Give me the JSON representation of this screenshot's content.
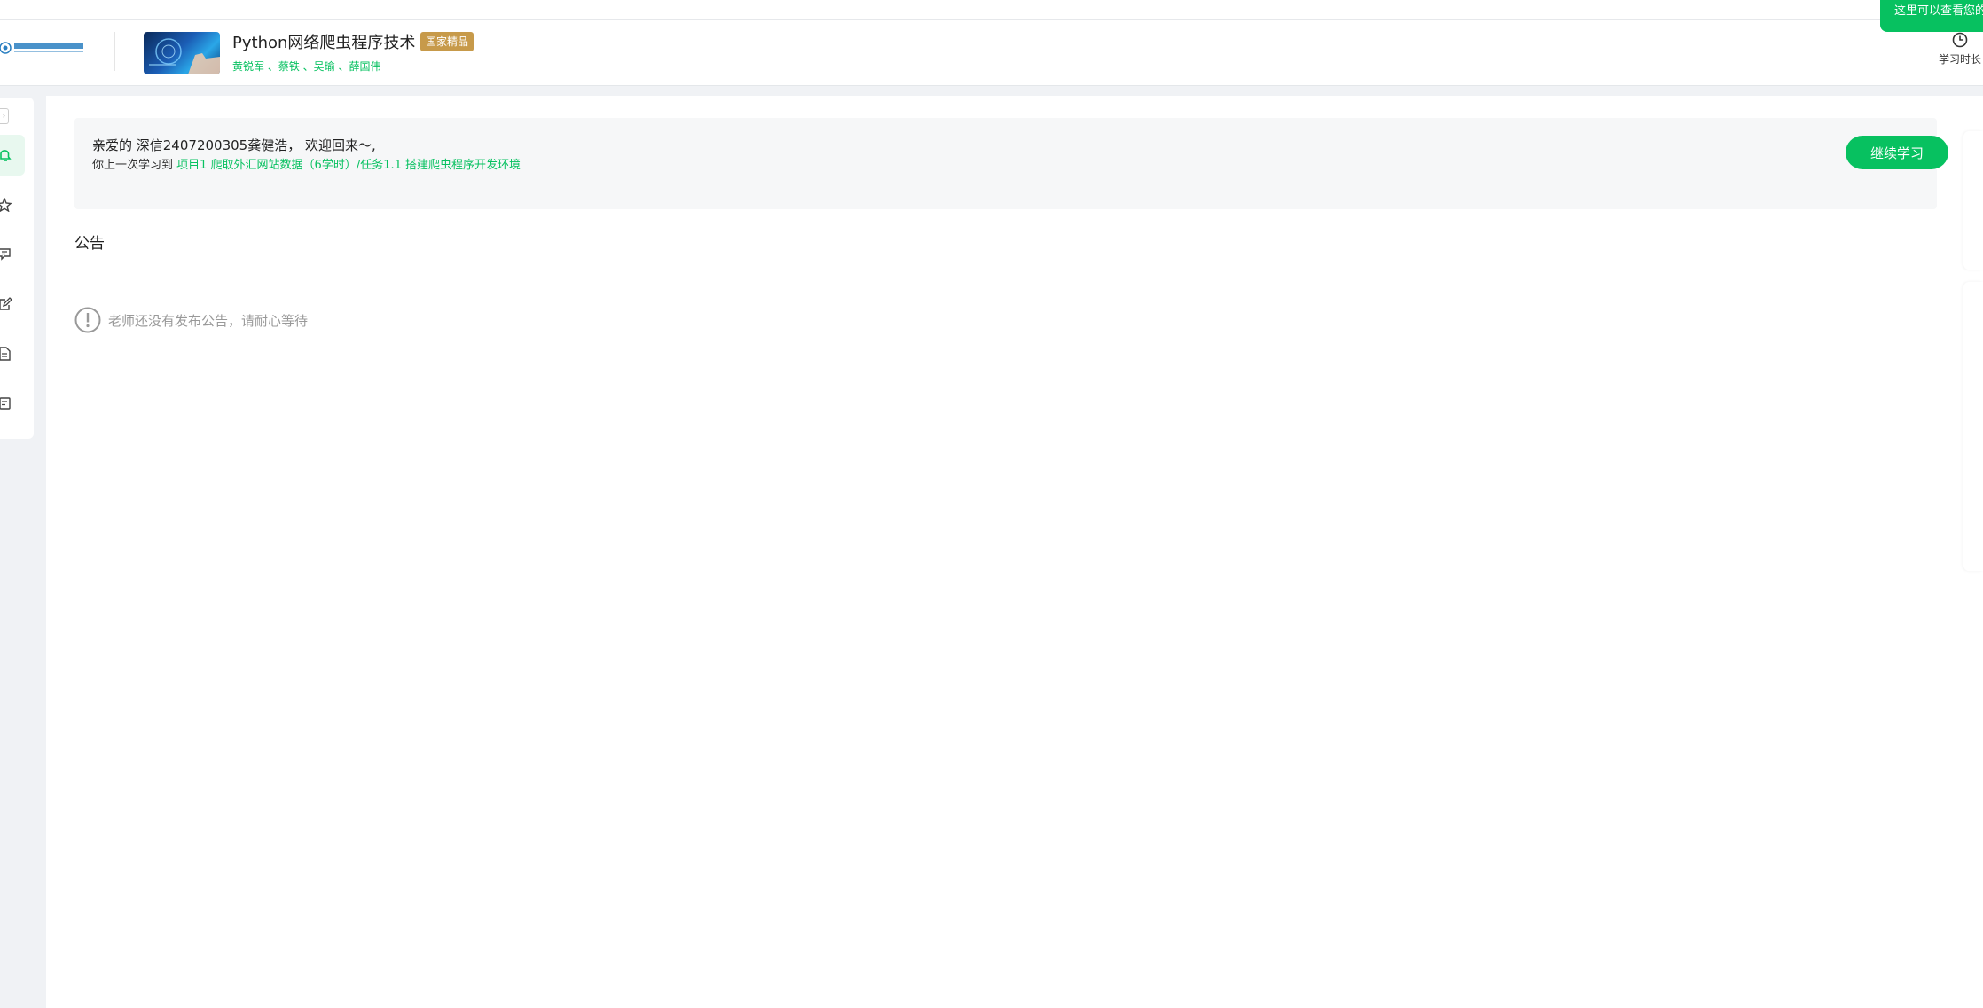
{
  "tooltip": {
    "text": "这里可以查看您的学"
  },
  "header": {
    "course_title": "Python网络爬虫程序技术",
    "badge": "国家精品",
    "teachers": "黄锐军 、蔡铁 、吴瑜 、薛国伟",
    "study_time_label": "学习时长"
  },
  "sidebar": {
    "items": [
      {
        "icon": "bell-icon",
        "active": true
      },
      {
        "icon": "star-icon",
        "active": false
      },
      {
        "icon": "discussion-icon",
        "active": false
      },
      {
        "icon": "edit-icon",
        "active": false
      },
      {
        "icon": "document-icon",
        "active": false
      },
      {
        "icon": "message-icon",
        "active": false
      }
    ]
  },
  "welcome": {
    "greeting": "亲爱的 深信2407200305龚健浩， 欢迎回来～,",
    "last_prefix": "你上一次学习到 ",
    "last_link": "项目1 爬取外汇网站数据（6学时）/任务1.1 搭建爬虫程序开发环境",
    "continue_label": "继续学习"
  },
  "announcement": {
    "title": "公告",
    "empty_text": "老师还没有发布公告，请耐心等待"
  },
  "colors": {
    "accent": "#07c160",
    "badge": "#c79a4a"
  }
}
